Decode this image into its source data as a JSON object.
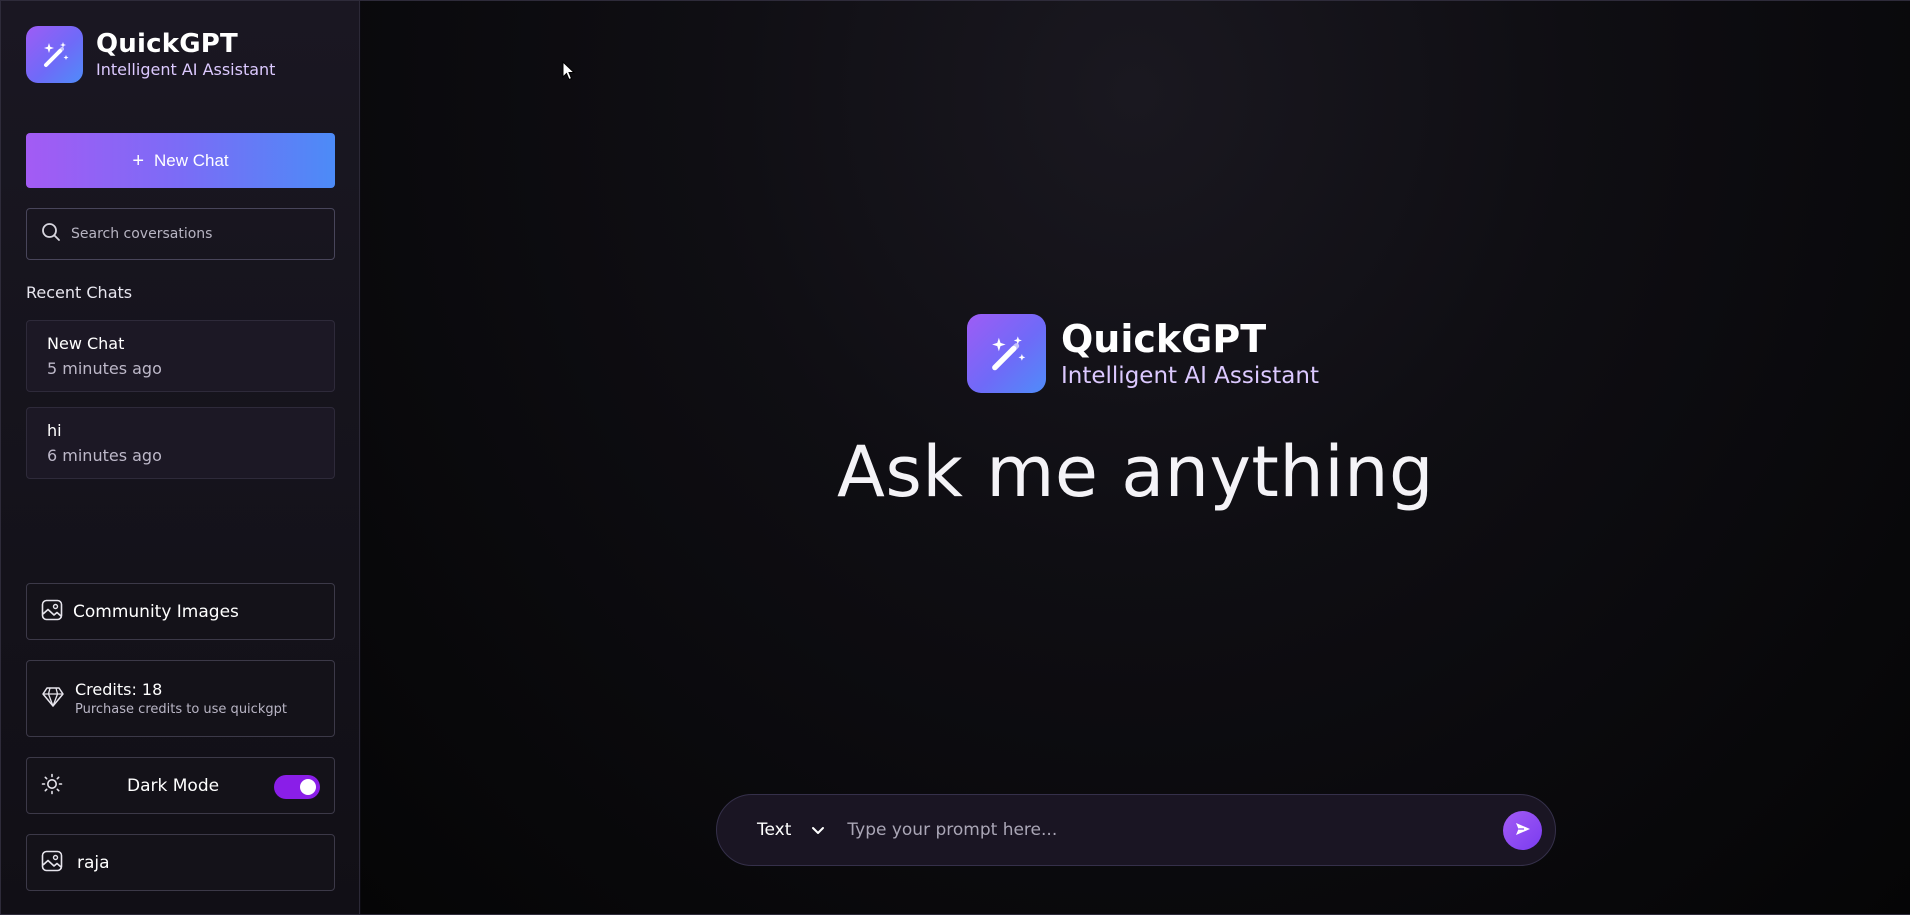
{
  "brand": {
    "title": "QuickGPT",
    "subtitle": "Intelligent AI Assistant"
  },
  "sidebar": {
    "new_chat_label": "New Chat",
    "search_placeholder": "Search coversations",
    "recent_title": "Recent Chats",
    "recent_chats": [
      {
        "title": "New Chat",
        "time": "5 minutes ago"
      },
      {
        "title": "hi",
        "time": "6 minutes ago"
      }
    ],
    "community_images_label": "Community Images",
    "credits": {
      "title": "Credits: 18",
      "subtitle": "Purchase credits to use quickgpt"
    },
    "dark_mode": {
      "label": "Dark Mode",
      "enabled": true
    },
    "user": {
      "name": "raja"
    }
  },
  "main": {
    "hero_title": "QuickGPT",
    "hero_subtitle": "Intelligent AI Assistant",
    "headline": "Ask me anything",
    "prompt": {
      "mode": "Text",
      "placeholder": "Type your prompt here..."
    }
  },
  "colors": {
    "accent_purple": "#a35bf4",
    "accent_blue": "#4c8bf7",
    "toggle_on": "#8a1ee8",
    "subtitle_lilac": "#dcc9ff"
  },
  "icons": {
    "logo": "magic-wand-icon",
    "new_chat": "plus-icon",
    "search": "search-icon",
    "community": "image-icon",
    "credits": "diamond-icon",
    "dark_mode": "sun-icon",
    "user": "image-icon",
    "mode": "chevron-down-icon",
    "send": "send-icon"
  }
}
